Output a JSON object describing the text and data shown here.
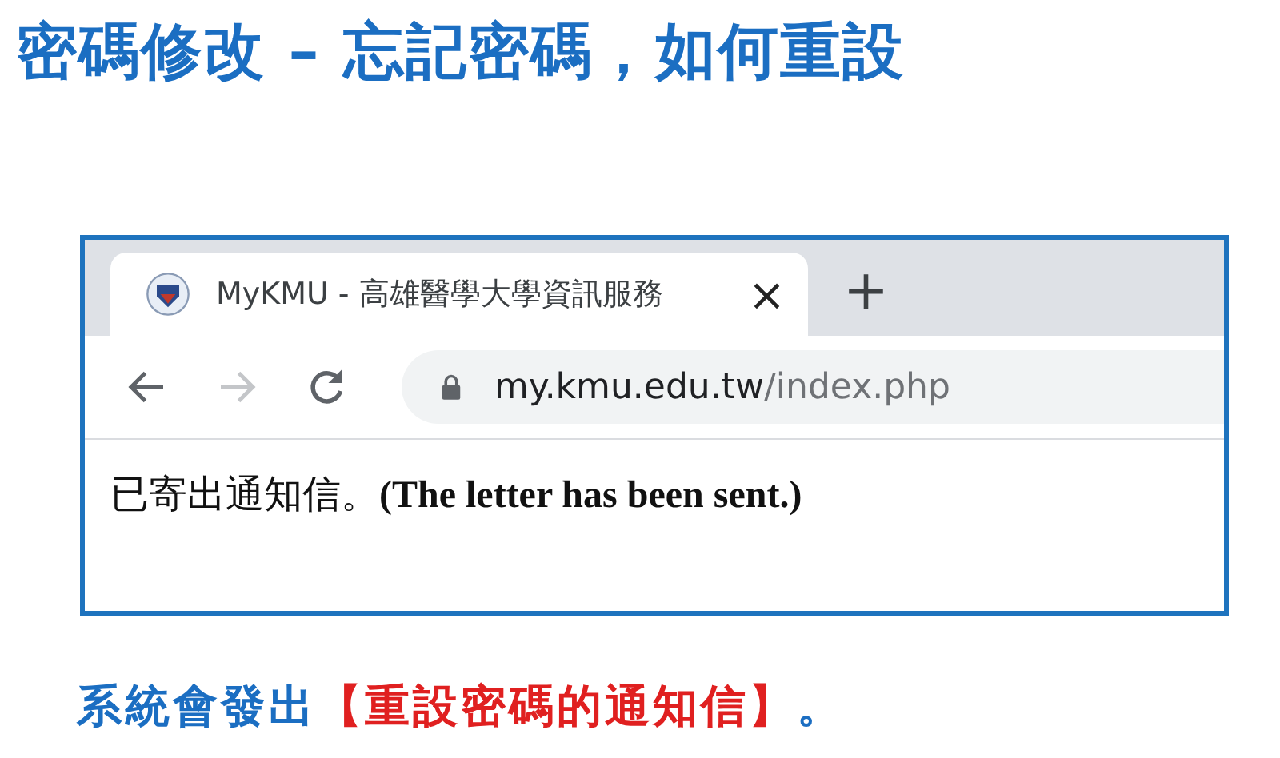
{
  "title": "密碼修改 – 忘記密碼，如何重設",
  "browser": {
    "tab": {
      "title": "MyKMU - 高雄醫學大學資訊服務",
      "close": "×",
      "selected": true
    },
    "new_tab": "+",
    "address": {
      "domain": "my.kmu.edu.tw",
      "path": "/index.php"
    },
    "forward_disabled": true,
    "message": "已寄出通知信。**(The letter has been sent.)**"
  },
  "caption": [
    {
      "text": "系統會發出",
      "emphasis": false
    },
    {
      "text": "【重設密碼的通知信】",
      "emphasis": true
    },
    {
      "text": "。",
      "emphasis": false
    }
  ]
}
